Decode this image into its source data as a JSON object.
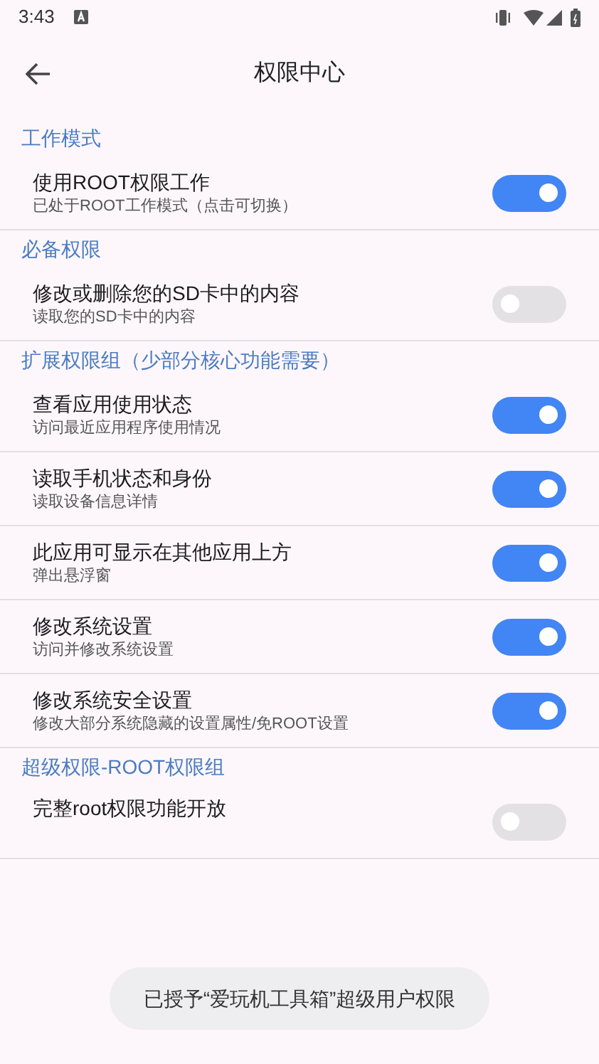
{
  "status_bar": {
    "time": "3:43"
  },
  "toolbar": {
    "title": "权限中心"
  },
  "sections": [
    {
      "header": "工作模式",
      "items": [
        {
          "title": "使用ROOT权限工作",
          "subtitle": "已处于ROOT工作模式（点击可切换）",
          "on": true
        }
      ]
    },
    {
      "header": "必备权限",
      "items": [
        {
          "title": "修改或删除您的SD卡中的内容",
          "subtitle": "读取您的SD卡中的内容",
          "on": false
        }
      ]
    },
    {
      "header": "扩展权限组（少部分核心功能需要）",
      "items": [
        {
          "title": "查看应用使用状态",
          "subtitle": "访问最近应用程序使用情况",
          "on": true
        },
        {
          "title": "读取手机状态和身份",
          "subtitle": "读取设备信息详情",
          "on": true
        },
        {
          "title": "此应用可显示在其他应用上方",
          "subtitle": "弹出悬浮窗",
          "on": true
        },
        {
          "title": "修改系统设置",
          "subtitle": "访问并修改系统设置",
          "on": true
        },
        {
          "title": "修改系统安全设置",
          "subtitle": "修改大部分系统隐藏的设置属性/免ROOT设置",
          "on": true
        }
      ]
    },
    {
      "header": "超级权限-ROOT权限组",
      "items": [
        {
          "title": "完整root权限功能开放",
          "on": false
        }
      ]
    }
  ],
  "toast": "已授予“爱玩机工具箱”超级用户权限"
}
